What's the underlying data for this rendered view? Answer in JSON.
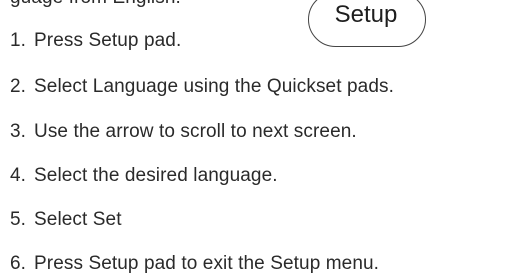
{
  "intro_fragment": "guage from English:",
  "setup_pad": {
    "label": "Setup"
  },
  "steps": [
    {
      "number": "1.",
      "text": "Press Setup pad."
    },
    {
      "number": "2.",
      "text": "Select Language using the Quickset pads."
    },
    {
      "number": "3.",
      "text": "Use the arrow to scroll to next screen."
    },
    {
      "number": "4.",
      "text": "Select the desired language."
    },
    {
      "number": "5.",
      "text": "Select Set"
    },
    {
      "number": "6.",
      "text": "Press Setup pad to exit the Setup menu."
    }
  ]
}
